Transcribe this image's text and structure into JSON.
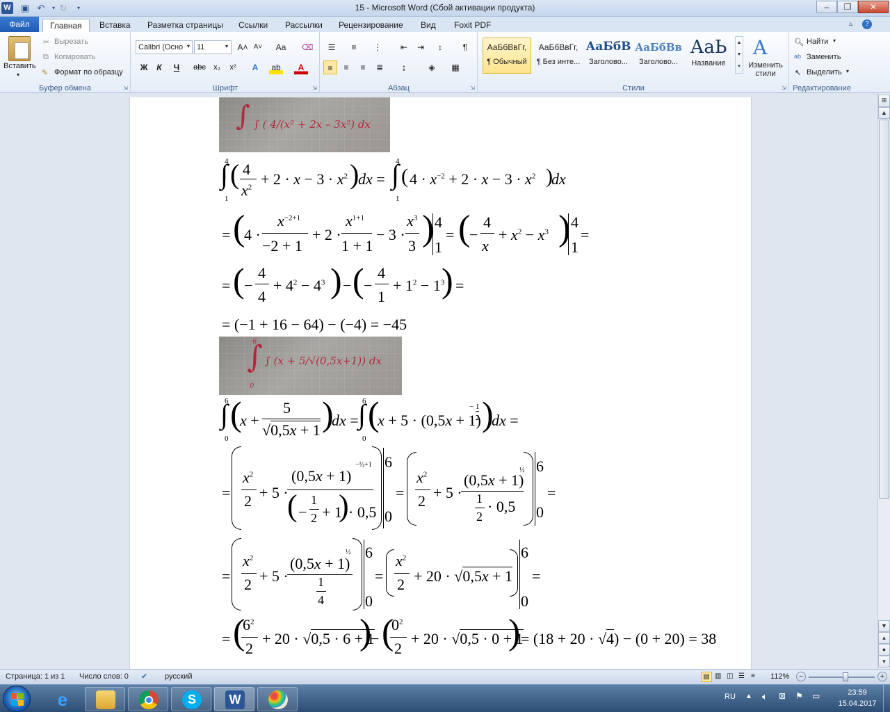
{
  "window": {
    "title": "15  -  Microsoft Word (Сбой активации продукта)",
    "app_logo": "W",
    "controls": [
      "–",
      "❐",
      "✕"
    ]
  },
  "ribbon_tabs": [
    "Файл",
    "Главная",
    "Вставка",
    "Разметка страницы",
    "Ссылки",
    "Рассылки",
    "Рецензирование",
    "Вид",
    "Foxit PDF"
  ],
  "clipboard": {
    "paste": "Вставить",
    "cut": "Вырезать",
    "copy": "Копировать",
    "format_painter": "Формат по образцу",
    "label": "Буфер обмена"
  },
  "font": {
    "name": "Calibri (Осно",
    "size": "11",
    "label": "Шрифт",
    "bold": "Ж",
    "italic": "К",
    "underline": "Ч",
    "strike": "abc",
    "subscript": "x₂",
    "superscript": "x²",
    "grow": "A˄",
    "shrink": "A˅",
    "case": "Aa",
    "color_letter": "A",
    "effects_letter": "A"
  },
  "paragraph": {
    "label": "Абзац",
    "pilcrow": "¶"
  },
  "styles": {
    "label": "Стили",
    "items": [
      {
        "preview": "АаБбВвГг,",
        "name": "¶ Обычный"
      },
      {
        "preview": "АаБбВвГг,",
        "name": "¶ Без инте..."
      },
      {
        "preview": "АаБбВ",
        "name": "Заголово..."
      },
      {
        "preview": "АаБбВв",
        "name": "Заголово..."
      },
      {
        "preview": "АаЬ",
        "name": "Название"
      }
    ],
    "change_styles": "Изменить стили"
  },
  "editing": {
    "label": "Редактирование",
    "find": "Найти",
    "replace": "Заменить",
    "select": "Выделить"
  },
  "document": {
    "photo1_text": "∫ ( 4/(x² + 2x – 3x²) dx",
    "photo2_text": "∫ (x + 5/√(0,5x+1)) dx",
    "photo2_lower": "0",
    "photo2_upper": "6",
    "eq1": {
      "lower": "1",
      "upper": "4",
      "text": "∫(4/x² + 2·x − 3·x²)dx = ∫(4·x⁻² + 2·x − 3·x²)dx"
    },
    "eq2": {
      "text": "= (4·x⁻²⁺¹/(−2+1) + 2·x¹⁺¹/(1+1) − 3·x³/3)|¹⁴ = (−4/x + x² − x³)|¹⁴ ="
    },
    "eq3": {
      "text": "= (−4/4 + 4² − 4³) − (−4/1 + 1² − 1³) ="
    },
    "eq4": {
      "text": "= (−1 + 16 − 64) − (−4) = −45"
    },
    "eq5": {
      "lower": "0",
      "upper": "6",
      "text": "∫(x + 5/√(0,5x+1))dx = ∫(x + 5·(0,5x+1)^(−1/2))dx ="
    },
    "eq6": {
      "text": "= (x²/2 + 5·(0,5x+1)^(−1/2+1)/((−1/2+1)·0,5))|₀⁶ = (x²/2 + 5·(0,5x+1)^(1/2)/(1/2·0,5))|₀⁶ ="
    },
    "eq7": {
      "text": "= (x²/2 + 5·(0,5x+1)^(1/2)/(1/4))|₀⁶ = (x²/2 + 20·√(0,5x+1))|₀⁶ ="
    },
    "eq8": {
      "text": "= (6²/2 + 20·√(0,5·6+1)) − (0²/2 + 20·√(0,5·0+1)) = (18 + 20·√4) − (0 + 20) = 38"
    }
  },
  "status": {
    "page": "Страница: 1 из 1",
    "words": "Число слов: 0",
    "language": "русский",
    "zoom": "112%",
    "zoom_fraction": 0.56
  },
  "taskbar": {
    "lang": "RU",
    "time": "23:59",
    "date": "15.04.2017",
    "apps": [
      "windows-explorer",
      "internet-explorer",
      "file-manager",
      "chrome",
      "skype",
      "word",
      "paint"
    ]
  }
}
